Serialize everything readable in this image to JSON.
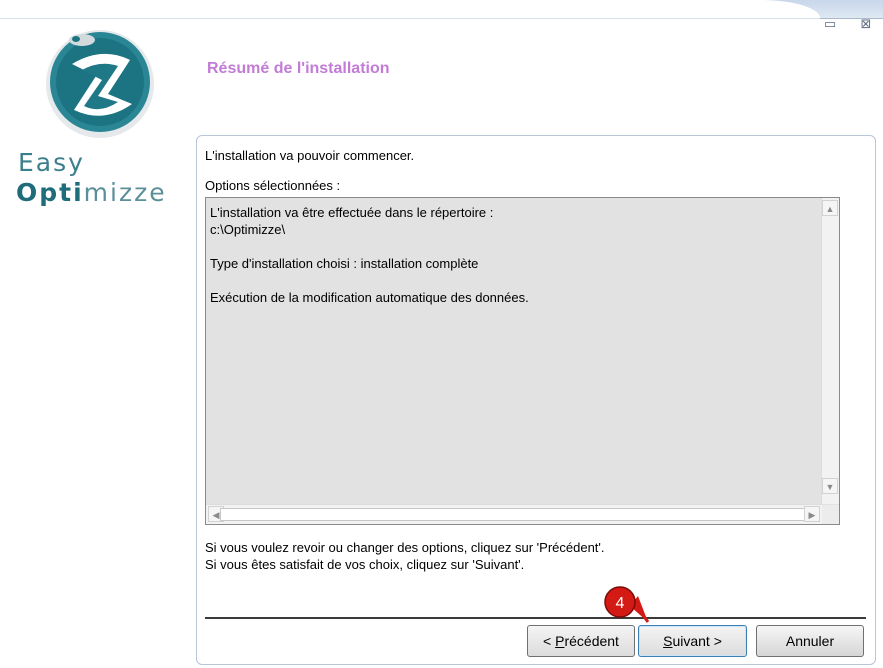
{
  "window": {
    "minimize_glyph": "▭",
    "close_glyph": "⊠"
  },
  "brand": {
    "line1": "Easy",
    "line2_part1": "Opti",
    "line2_part2": "mizze"
  },
  "page_title": "Résumé de l'installation",
  "intro_text": "L'installation va pouvoir commencer.",
  "options_label": "Options sélectionnées :",
  "summary_lines": "L'installation va être effectuée dans le répertoire :\nc:\\Optimizze\\\n\nType d'installation choisi : installation complète\n\nExécution de la modification automatique des données.",
  "footer_text_1": "Si vous voulez revoir ou changer des options, cliquez sur 'Précédent'.",
  "footer_text_2": "Si vous êtes satisfait de vos choix, cliquez sur 'Suivant'.",
  "buttons": {
    "previous": "< Précédent",
    "next": "Suivant >",
    "cancel": "Annuler"
  },
  "step_marker": "4",
  "colors": {
    "title": "#c27cd6",
    "brand": "#1f6c7a",
    "marker": "#d41a14"
  }
}
